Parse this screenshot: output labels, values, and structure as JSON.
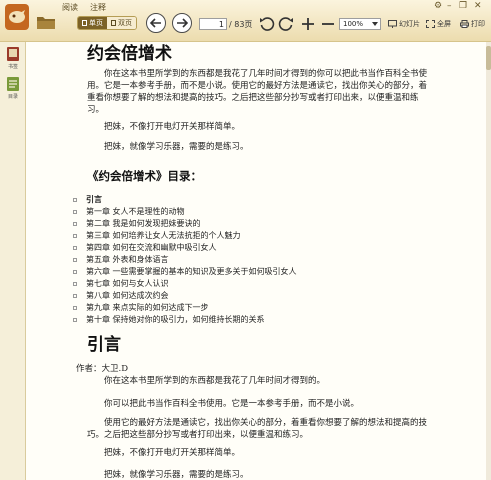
{
  "menu": {
    "tab_read": "阅读",
    "tab_annotate": "注释"
  },
  "toolbar": {
    "view_single": "单页",
    "view_double": "双页",
    "page_current": "1",
    "page_total": "/ 83页",
    "zoom": "100%",
    "slideshow": "幻灯片",
    "fullscreen": "全屏",
    "print": "打印"
  },
  "sidebar": {
    "items": [
      {
        "label": "书签"
      },
      {
        "label": "目录"
      }
    ]
  },
  "doc": {
    "title": "约会倍增术",
    "intro_paragraphs": [
      "你在这本书里所学到的东西都是我花了几年时间才得到的你可以把此书当作百科全书使用。它是一本参考手册，而不是小说。使用它的最好方法是通读它，找出你关心的部分，着重看你想要了解的想法和提高的技巧。之后把这些部分抄写或者打印出来，以便重温和练习。",
      "把妹，不像打开电灯开关那样简单。",
      "把妹，就像学习乐器，需要的是练习。"
    ],
    "toc_heading": "《约会倍增术》目录：",
    "toc": [
      "引言",
      "第一章 女人不是理性的动物",
      "第二章 我是如何发现把妹要诀的",
      "第三章 如何培养让女人无法抗拒的个人魅力",
      "第四章 如何在交流和幽默中吸引女人",
      "第五章 外表和身体语言",
      "第六章 一些需要掌握的基本的知识及更多关于如何吸引女人",
      "第七章 如何与女人认识",
      "第八章 如何达成次约会",
      "第九章 来点实际的如何达成下一步",
      "第十章 保持她对你的吸引力，如何维持长期的关系"
    ],
    "section_title": "引言",
    "author": "作者：大卫.D",
    "section_paragraphs": [
      "你在这本书里所学到的东西都是我花了几年时间才得到的。",
      "你可以把此书当作百科全书使用。它是一本参考手册，而不是小说。",
      "使用它的最好方法是通读它，找出你关心的部分，着重看你想要了解的想法和提高的技巧。之后把这些部分抄写或者打印出来，以便重温和练习。",
      "把妹，不像打开电灯开关那样简单。",
      "把妹，就像学习乐器，需要的是练习。"
    ]
  }
}
